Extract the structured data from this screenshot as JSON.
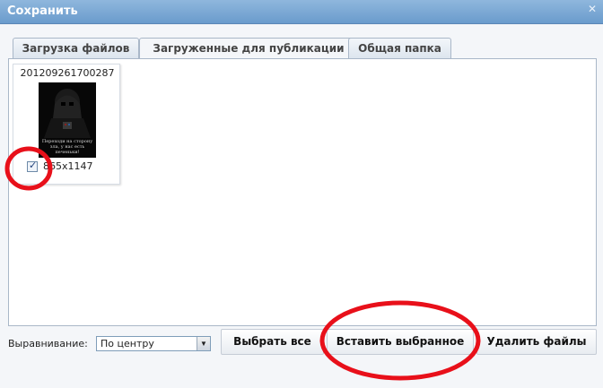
{
  "window": {
    "title": "Сохранить",
    "close_icon": "close-icon"
  },
  "tabs": [
    {
      "label": "Загрузка файлов",
      "active": false
    },
    {
      "label": "Загруженные для публикации",
      "active": true
    },
    {
      "label": "Общая папка",
      "active": false
    }
  ],
  "files": [
    {
      "name": "201209261700287",
      "dimensions": "865x1147",
      "checked": true,
      "image_caption": "Переходи на сторону зла, у нас есть печеньки!"
    }
  ],
  "alignment": {
    "label": "Выравнивание:",
    "selected": "По центру"
  },
  "buttons": {
    "select_all": "Выбрать все",
    "insert_selected": "Вставить выбранное",
    "delete_files": "Удалить файлы"
  },
  "annotations": {
    "highlight_color": "#e8101a"
  },
  "colors": {
    "titlebar": "#7aa7d6",
    "panel_border": "#a9b7c8"
  }
}
